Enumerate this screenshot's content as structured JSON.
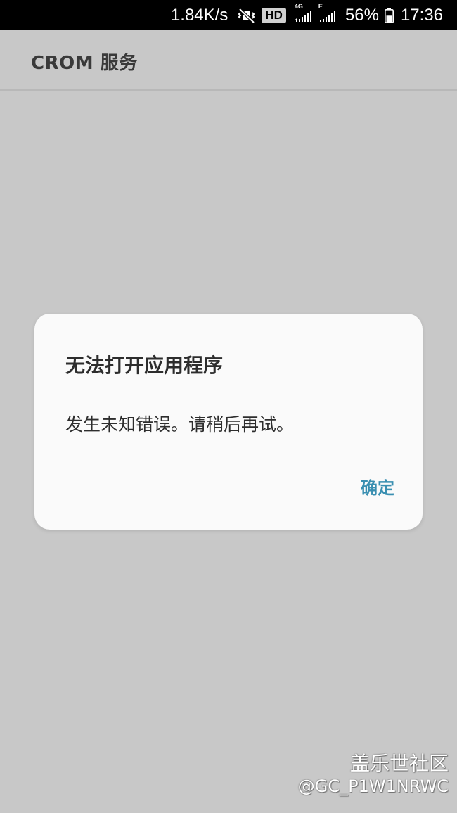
{
  "status_bar": {
    "network_speed": "1.84K/s",
    "mute_icon": "vibrate-mute-icon",
    "hd_badge": "HD",
    "sim1_tag": "4G",
    "sim2_tag": "E",
    "signal_icon": "signal-bars-icon",
    "battery_percent": "56%",
    "battery_icon": "battery-icon",
    "battery_level": 56,
    "time": "17:36"
  },
  "app_bar": {
    "title": "CROM 服务"
  },
  "dialog": {
    "title": "无法打开应用程序",
    "message": "发生未知错误。请稍后再试。",
    "confirm_label": "确定",
    "accent_color": "#3a8fb1"
  },
  "watermark": {
    "line1": "盖乐世社区",
    "line2": "@GC_P1W1NRWC"
  }
}
